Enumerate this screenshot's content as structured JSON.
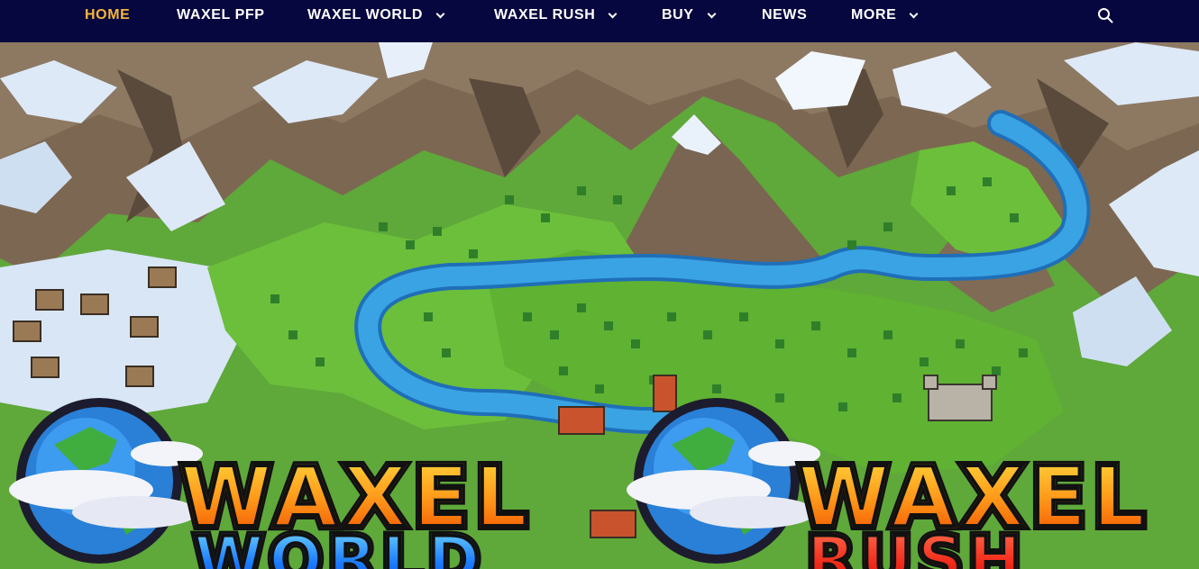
{
  "nav": {
    "items": [
      {
        "label": "HOME",
        "active": true,
        "dropdown": false
      },
      {
        "label": "WAXEL PFP",
        "active": false,
        "dropdown": false
      },
      {
        "label": "WAXEL WORLD",
        "active": false,
        "dropdown": true
      },
      {
        "label": "WAXEL RUSH",
        "active": false,
        "dropdown": true
      },
      {
        "label": "BUY",
        "active": false,
        "dropdown": true
      },
      {
        "label": "NEWS",
        "active": false,
        "dropdown": false
      },
      {
        "label": "MORE",
        "active": false,
        "dropdown": true
      }
    ],
    "search_icon": "search-icon"
  },
  "hero": {
    "logos": [
      {
        "line1": "WAXEL",
        "line2": "WORLD"
      },
      {
        "line1": "WAXEL",
        "line2": "RUSH"
      }
    ]
  },
  "colors": {
    "nav_bg": "#07073f",
    "nav_active": "#f4b63a",
    "nav_text": "#ffffff",
    "grass": "#6cbf3a",
    "river": "#2f95d8",
    "mountain": "#7a6550",
    "snow": "#dde9f7",
    "logo_orange": "#ff8c00",
    "logo_blue": "#1a7bff",
    "logo_red": "#f22a1a"
  }
}
